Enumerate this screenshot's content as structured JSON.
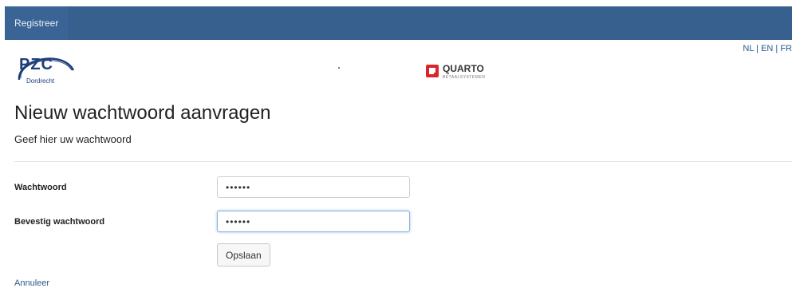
{
  "nav": {
    "register_label": "Registreer"
  },
  "language_switch": {
    "nl": "NL",
    "en": "EN",
    "fr": "FR",
    "separator": "|"
  },
  "logos": {
    "pzc": {
      "text": "PZC",
      "subtext": "Dordrecht"
    },
    "quarto": {
      "text": "QUARTO",
      "subtext": "BETAALSYSTEMEN"
    }
  },
  "page": {
    "title": "Nieuw wachtwoord aanvragen",
    "subtitle": "Geef hier uw wachtwoord"
  },
  "form": {
    "password_label": "Wachtwoord",
    "password_value": "••••••",
    "confirm_label": "Bevestig wachtwoord",
    "confirm_value": "••••••",
    "save_label": "Opslaan",
    "cancel_label": "Annuleer"
  },
  "colors": {
    "topbar": "#37608f",
    "link": "#2a5a8c",
    "logo_blue": "#1f3f7a",
    "quarto_red": "#d9262c"
  }
}
